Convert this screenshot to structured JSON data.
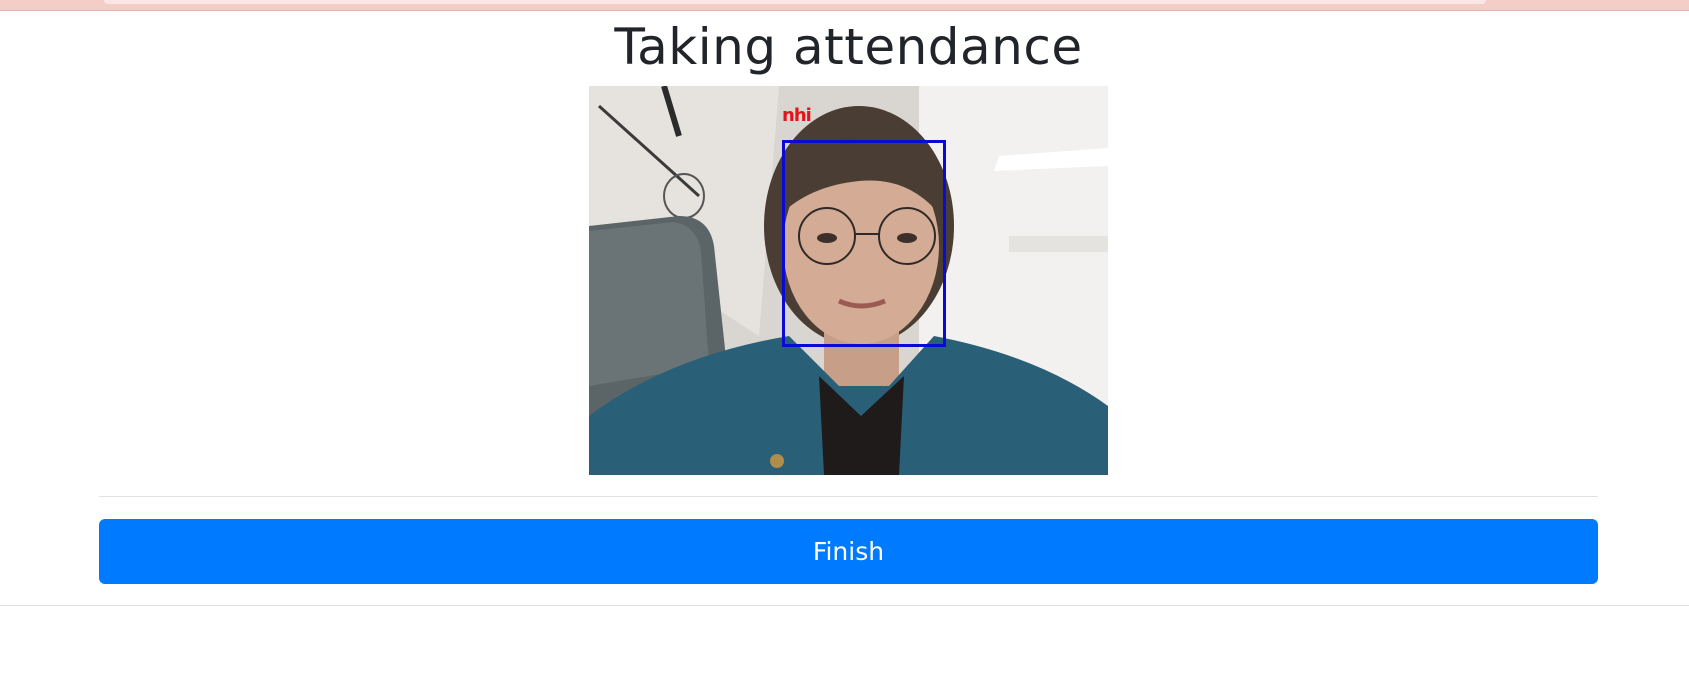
{
  "page": {
    "title": "Taking attendance"
  },
  "camera": {
    "detected_name": "nhi",
    "box_color": "#0a0ad6",
    "label_color": "#e0141b"
  },
  "actions": {
    "finish_label": "Finish",
    "finish_color": "#007bff"
  }
}
